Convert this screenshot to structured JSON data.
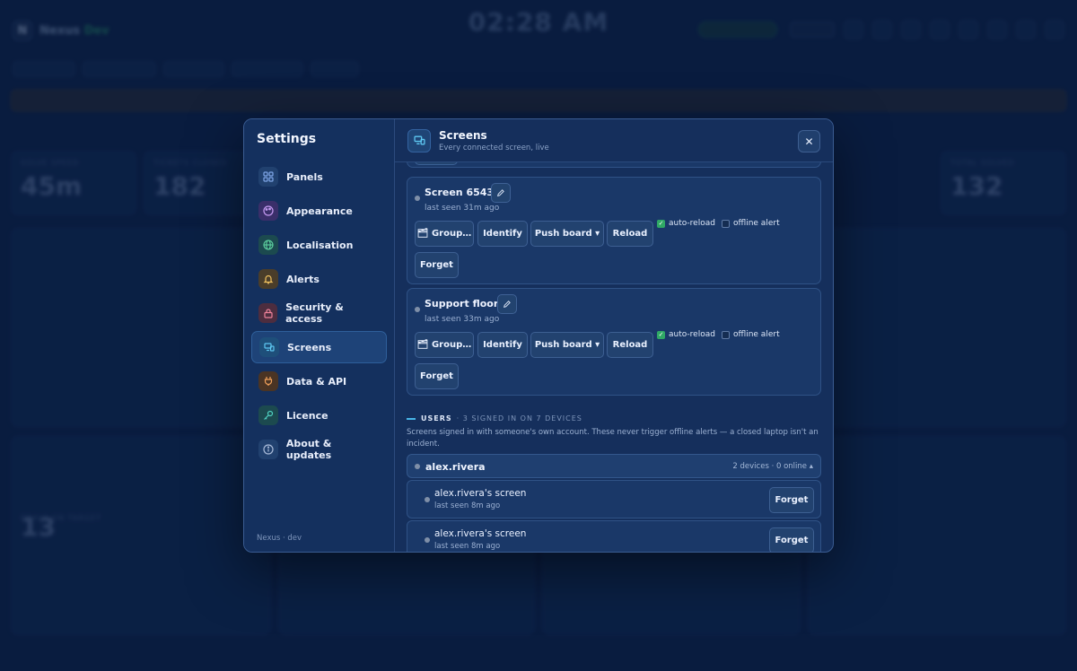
{
  "background": {
    "brand": "Nexus",
    "brand_suffix": "Dev",
    "clock": "02:28 AM",
    "stats": [
      {
        "label": "SOLVE SPEED",
        "value": "45m"
      },
      {
        "label": "TICKETS CLOSED",
        "value": "182"
      },
      {
        "label": "TOTAL SOLVED",
        "value": "132"
      },
      {
        "label": "DEALS ON TARGET",
        "value": "13"
      }
    ]
  },
  "settings": {
    "title": "Settings",
    "footer": "Nexus · dev",
    "nav": [
      {
        "label": "Panels",
        "icon": "grid-icon"
      },
      {
        "label": "Appearance",
        "icon": "palette-icon"
      },
      {
        "label": "Localisation",
        "icon": "globe-icon"
      },
      {
        "label": "Alerts",
        "icon": "bell-icon"
      },
      {
        "label": "Security & access",
        "icon": "lock-icon"
      },
      {
        "label": "Screens",
        "icon": "screens-icon"
      },
      {
        "label": "Data & API",
        "icon": "plug-icon"
      },
      {
        "label": "Licence",
        "icon": "key-icon"
      },
      {
        "label": "About & updates",
        "icon": "info-icon"
      }
    ],
    "active_nav": "Screens"
  },
  "panel": {
    "title": "Screens",
    "subtitle": "Every connected screen, live",
    "close_label": "✕",
    "screens": [
      {
        "name": "Screen 6543",
        "last_seen": "last seen 31m ago",
        "buttons": {
          "group": "🗂 Group…",
          "identify": "Identify",
          "push": "Push board ▾",
          "reload": "Reload",
          "forget": "Forget"
        },
        "auto_reload_label": "auto-reload",
        "auto_reload": true,
        "offline_alert_label": "offline alert",
        "offline_alert": false
      },
      {
        "name": "Support floor",
        "last_seen": "last seen 33m ago",
        "buttons": {
          "group": "🗂 Group…",
          "identify": "Identify",
          "push": "Push board ▾",
          "reload": "Reload",
          "forget": "Forget"
        },
        "auto_reload_label": "auto-reload",
        "auto_reload": true,
        "offline_alert_label": "offline alert",
        "offline_alert": false
      }
    ],
    "users": {
      "heading": "USERS",
      "count": "· 3 SIGNED IN ON 7 DEVICES",
      "description": "Screens signed in with someone's own account. These never trigger offline alerts — a closed laptop isn't an incident.",
      "user": {
        "name": "alex.rivera",
        "meta": "2 devices · 0 online ▴",
        "devices": [
          {
            "name": "alex.rivera's screen",
            "last_seen": "last seen 8m ago",
            "forget": "Forget"
          },
          {
            "name": "alex.rivera's screen",
            "last_seen": "last seen 8m ago",
            "forget": "Forget"
          }
        ]
      }
    }
  }
}
